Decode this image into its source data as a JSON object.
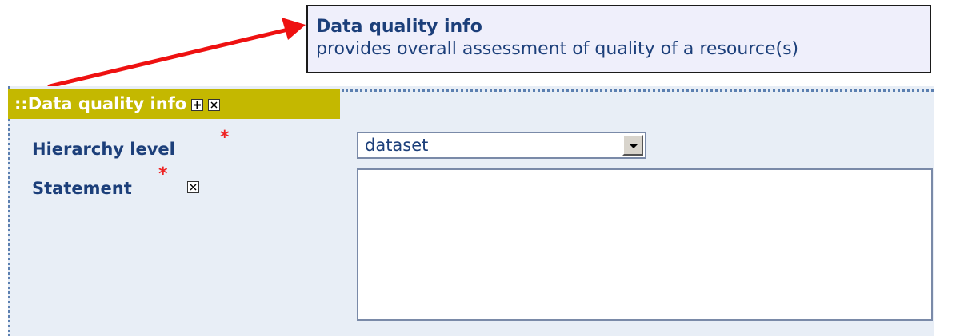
{
  "tooltip": {
    "title": "Data quality info",
    "text": "provides overall assessment of quality of a resource(s)"
  },
  "section": {
    "title": "::Data quality info",
    "add_icon": "plus-box-icon",
    "remove_icon": "x-box-icon",
    "header_color": "#c4b800"
  },
  "fields": {
    "hierarchy_level": {
      "label": "Hierarchy level",
      "required_mark": "*",
      "selected_value": "dataset"
    },
    "statement": {
      "label": "Statement",
      "required_mark": "*",
      "remove_icon": "x-box-icon",
      "value": ""
    }
  },
  "colors": {
    "label_text": "#1c3f7a",
    "required": "#ee2222",
    "panel_bg": "#e8eef6",
    "arrow": "#ee1111"
  }
}
